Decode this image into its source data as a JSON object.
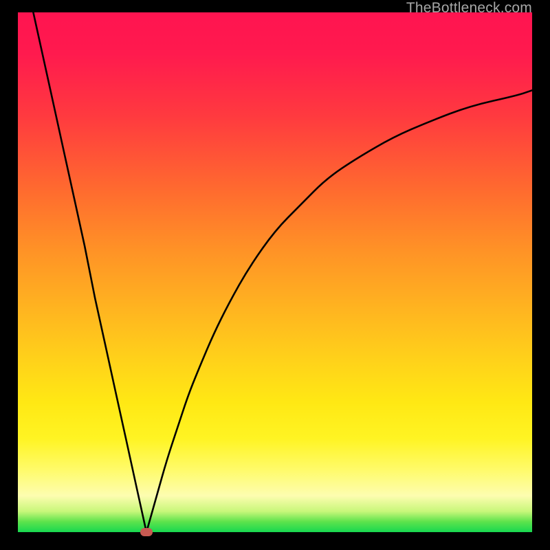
{
  "watermark": "TheBottleneck.com",
  "chart_data": {
    "type": "line",
    "title": "",
    "xlabel": "",
    "ylabel": "",
    "xlim": [
      0,
      100
    ],
    "ylim": [
      0,
      100
    ],
    "vertex": {
      "x": 25,
      "y": 0
    },
    "gradient_colors": {
      "top": "#ff1450",
      "mid": "#ffd21a",
      "bottom": "#18d850"
    },
    "series": [
      {
        "name": "left-branch",
        "x": [
          3,
          5,
          7,
          9,
          11,
          13,
          15,
          17,
          19,
          21,
          23,
          25
        ],
        "values": [
          100,
          91,
          82,
          73,
          64,
          55,
          45,
          36,
          27,
          18,
          9,
          0
        ]
      },
      {
        "name": "right-branch",
        "x": [
          25,
          27,
          29,
          31,
          33,
          35,
          38,
          41,
          45,
          50,
          55,
          60,
          66,
          73,
          80,
          88,
          97,
          100
        ],
        "values": [
          0,
          7,
          14,
          20,
          26,
          31,
          38,
          44,
          51,
          58,
          63,
          68,
          72,
          76,
          79,
          82,
          84,
          85
        ]
      }
    ]
  }
}
